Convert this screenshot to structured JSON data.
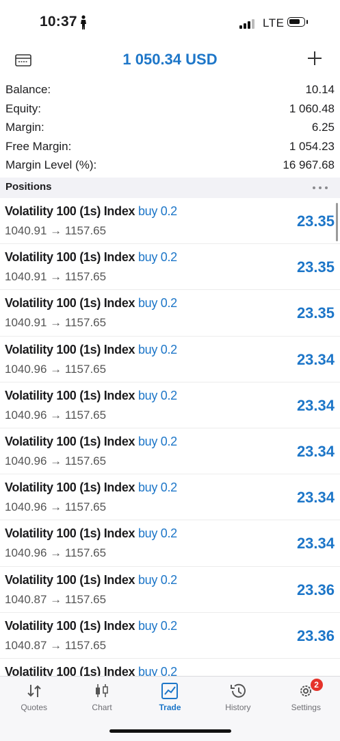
{
  "status_bar": {
    "time": "10:37",
    "network": "LTE"
  },
  "header": {
    "title": "1 050.34 USD"
  },
  "account": [
    {
      "label": "Balance:",
      "value": "10.14"
    },
    {
      "label": "Equity:",
      "value": "1 060.48"
    },
    {
      "label": "Margin:",
      "value": "6.25"
    },
    {
      "label": "Free Margin:",
      "value": "1 054.23"
    },
    {
      "label": "Margin Level (%):",
      "value": "16 967.68"
    }
  ],
  "positions_header": "Positions",
  "positions": [
    {
      "symbol": "Volatility 100 (1s) Index",
      "side": "buy 0.2",
      "prices": "1040.91 → 1157.65",
      "profit": "23.35"
    },
    {
      "symbol": "Volatility 100 (1s) Index",
      "side": "buy 0.2",
      "prices": "1040.91 → 1157.65",
      "profit": "23.35"
    },
    {
      "symbol": "Volatility 100 (1s) Index",
      "side": "buy 0.2",
      "prices": "1040.91 → 1157.65",
      "profit": "23.35"
    },
    {
      "symbol": "Volatility 100 (1s) Index",
      "side": "buy 0.2",
      "prices": "1040.96 → 1157.65",
      "profit": "23.34"
    },
    {
      "symbol": "Volatility 100 (1s) Index",
      "side": "buy 0.2",
      "prices": "1040.96 → 1157.65",
      "profit": "23.34"
    },
    {
      "symbol": "Volatility 100 (1s) Index",
      "side": "buy 0.2",
      "prices": "1040.96 → 1157.65",
      "profit": "23.34"
    },
    {
      "symbol": "Volatility 100 (1s) Index",
      "side": "buy 0.2",
      "prices": "1040.96 → 1157.65",
      "profit": "23.34"
    },
    {
      "symbol": "Volatility 100 (1s) Index",
      "side": "buy 0.2",
      "prices": "1040.96 → 1157.65",
      "profit": "23.34"
    },
    {
      "symbol": "Volatility 100 (1s) Index",
      "side": "buy 0.2",
      "prices": "1040.87 → 1157.65",
      "profit": "23.36"
    },
    {
      "symbol": "Volatility 100 (1s) Index",
      "side": "buy 0.2",
      "prices": "1040.87 → 1157.65",
      "profit": "23.36"
    },
    {
      "symbol": "Volatility 100 (1s) Index",
      "side": "buy 0.2",
      "prices": "",
      "profit": ""
    }
  ],
  "tabs": [
    {
      "label": "Quotes",
      "icon": "quotes-icon"
    },
    {
      "label": "Chart",
      "icon": "chart-icon"
    },
    {
      "label": "Trade",
      "icon": "trade-icon",
      "active": true
    },
    {
      "label": "History",
      "icon": "history-icon"
    },
    {
      "label": "Settings",
      "icon": "settings-icon",
      "badge": "2"
    }
  ],
  "colors": {
    "accent": "#1d76c8",
    "badge": "#e5332a"
  }
}
